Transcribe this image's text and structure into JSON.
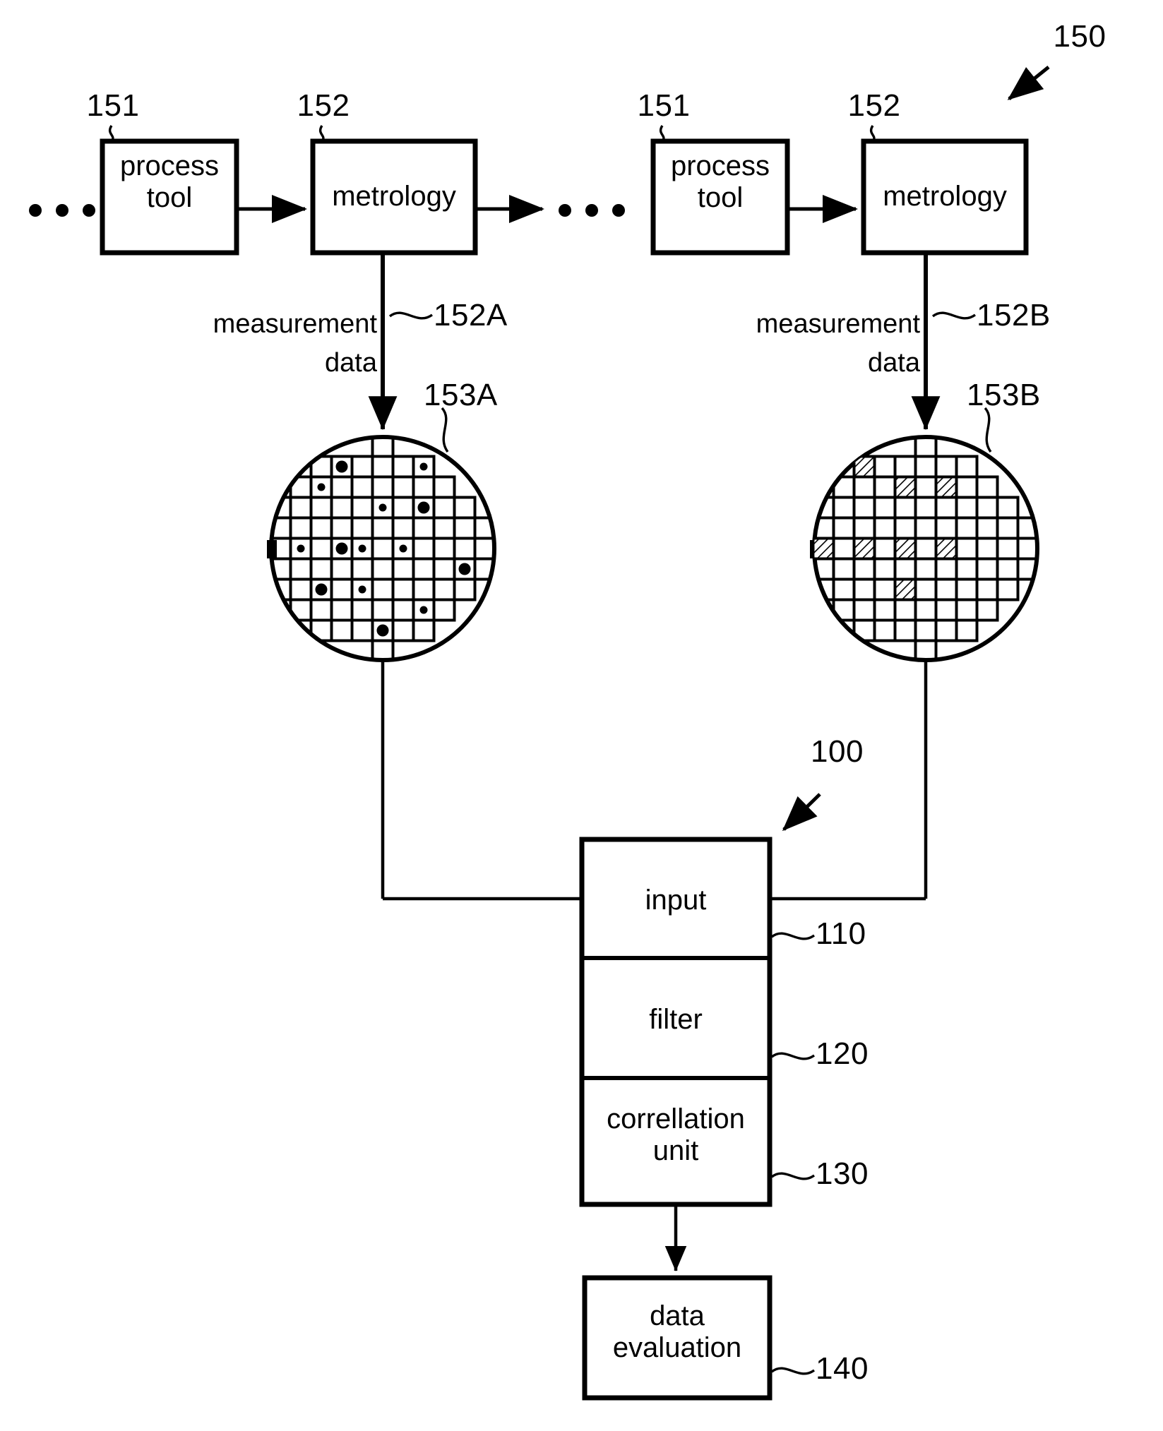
{
  "figure": {
    "type": "patent-flow-diagram",
    "background_color": "#ffffff",
    "line_color": "#000000"
  },
  "system": {
    "reference_number": "150",
    "overall_reference_number": "100"
  },
  "process_chain": {
    "leading_ellipsis": "• • •",
    "middle_ellipsis": "• • •",
    "stages": [
      {
        "process_tool": {
          "label": "process\ntool",
          "reference_number": "151"
        },
        "metrology": {
          "label": "metrology",
          "reference_number": "152"
        },
        "measurement_data": {
          "label": "measurement\ndata",
          "reference_number": "152A"
        },
        "wafer": {
          "reference_number": "153A",
          "marker_style": "filled-dots"
        }
      },
      {
        "process_tool": {
          "label": "process\ntool",
          "reference_number": "151"
        },
        "metrology": {
          "label": "metrology",
          "reference_number": "152"
        },
        "measurement_data": {
          "label": "measurement\ndata",
          "reference_number": "152B"
        },
        "wafer": {
          "reference_number": "153B",
          "marker_style": "hatched-cells"
        }
      }
    ]
  },
  "analysis_unit": {
    "reference_number": "100",
    "blocks": [
      {
        "label": "input",
        "reference_number": "110"
      },
      {
        "label": "filter",
        "reference_number": "120"
      },
      {
        "label": "correllation\nunit",
        "reference_number": "130"
      }
    ]
  },
  "output_block": {
    "label": "data\nevaluation",
    "reference_number": "140"
  },
  "wafer_maps": {
    "wafer_a": {
      "reference_number": "153A",
      "grid_columns": 11,
      "grid_rows": 11,
      "cell_marks": [
        {
          "row": 1,
          "col": 3,
          "size": "large"
        },
        {
          "row": 1,
          "col": 7,
          "size": "small"
        },
        {
          "row": 2,
          "col": 2,
          "size": "small"
        },
        {
          "row": 3,
          "col": 5,
          "size": "small"
        },
        {
          "row": 3,
          "col": 7,
          "size": "large"
        },
        {
          "row": 5,
          "col": 1,
          "size": "small"
        },
        {
          "row": 5,
          "col": 3,
          "size": "large"
        },
        {
          "row": 5,
          "col": 4,
          "size": "small"
        },
        {
          "row": 5,
          "col": 6,
          "size": "small"
        },
        {
          "row": 6,
          "col": 9,
          "size": "large"
        },
        {
          "row": 7,
          "col": 2,
          "size": "large"
        },
        {
          "row": 7,
          "col": 4,
          "size": "small"
        },
        {
          "row": 8,
          "col": 7,
          "size": "small"
        },
        {
          "row": 9,
          "col": 5,
          "size": "large"
        }
      ]
    },
    "wafer_b": {
      "reference_number": "153B",
      "grid_columns": 11,
      "grid_rows": 11,
      "hatched_cells": [
        {
          "row": 1,
          "col": 2
        },
        {
          "row": 2,
          "col": 4
        },
        {
          "row": 2,
          "col": 6
        },
        {
          "row": 5,
          "col": 0
        },
        {
          "row": 5,
          "col": 2
        },
        {
          "row": 5,
          "col": 4
        },
        {
          "row": 5,
          "col": 6
        },
        {
          "row": 7,
          "col": 4
        }
      ]
    }
  }
}
